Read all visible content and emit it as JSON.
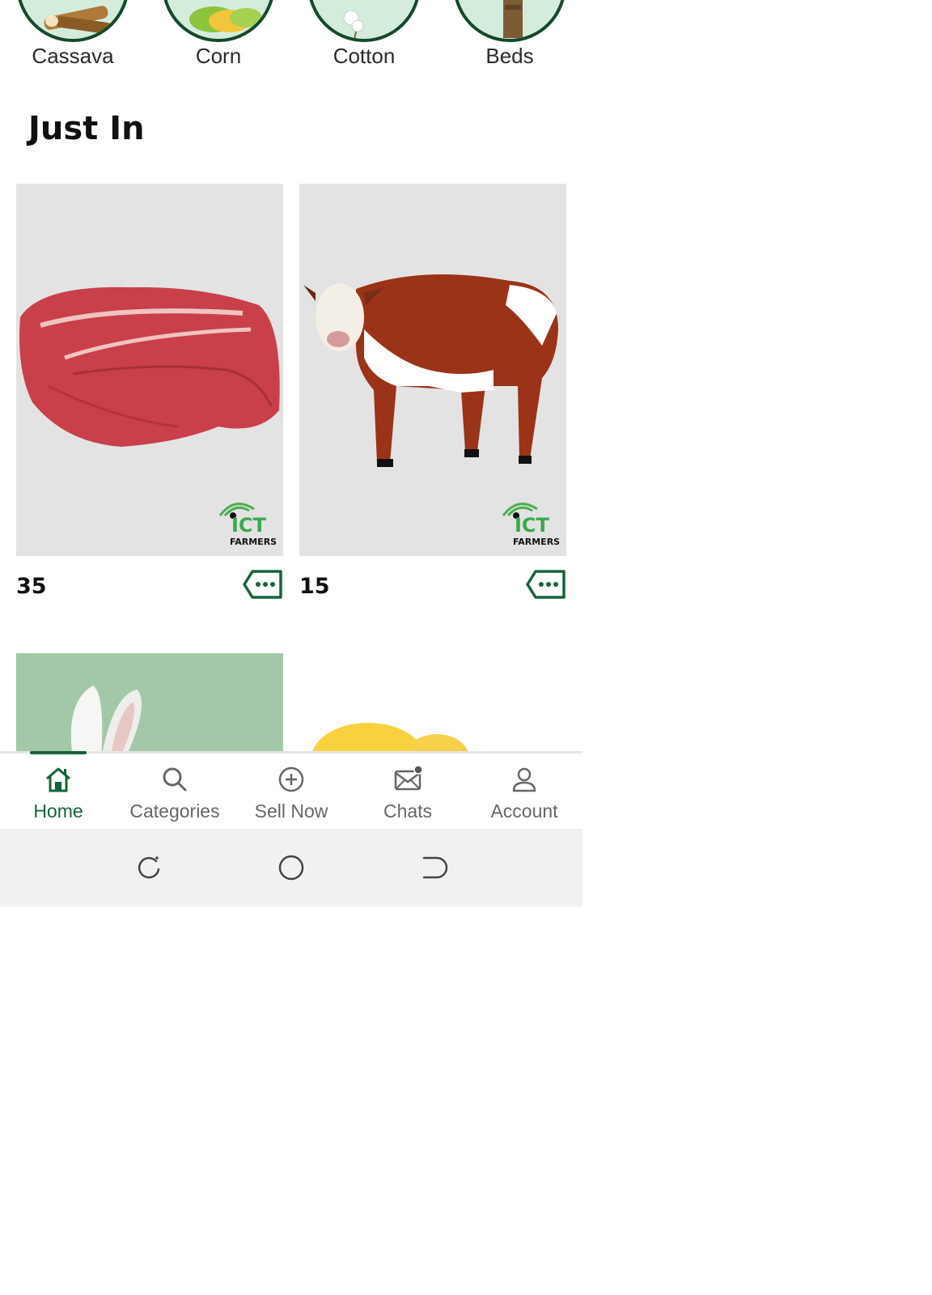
{
  "categories": [
    {
      "label": "Cassava"
    },
    {
      "label": "Corn"
    },
    {
      "label": "Cotton"
    },
    {
      "label": "Beds"
    }
  ],
  "section": {
    "title": "Just In"
  },
  "products": [
    {
      "price": "35",
      "image": "raw-beef-steak",
      "logo": "ICT FARMERS"
    },
    {
      "price": "15",
      "image": "brown-white-cow",
      "logo": "ICT FARMERS"
    },
    {
      "image": "white-rabbit"
    },
    {
      "image": "yellow-chicks"
    }
  ],
  "nav": {
    "items": [
      {
        "label": "Home",
        "icon": "home-icon",
        "active": true
      },
      {
        "label": "Categories",
        "icon": "search-icon"
      },
      {
        "label": "Sell Now",
        "icon": "plus-circle-icon"
      },
      {
        "label": "Chats",
        "icon": "mail-icon"
      },
      {
        "label": "Account",
        "icon": "user-icon"
      }
    ]
  },
  "colors": {
    "brand": "#15653a",
    "circle_bg": "#d4ecdc",
    "circle_border": "#15492b",
    "card_bg": "#e3e3e3",
    "rabbit_bg": "#a2c8a8"
  }
}
